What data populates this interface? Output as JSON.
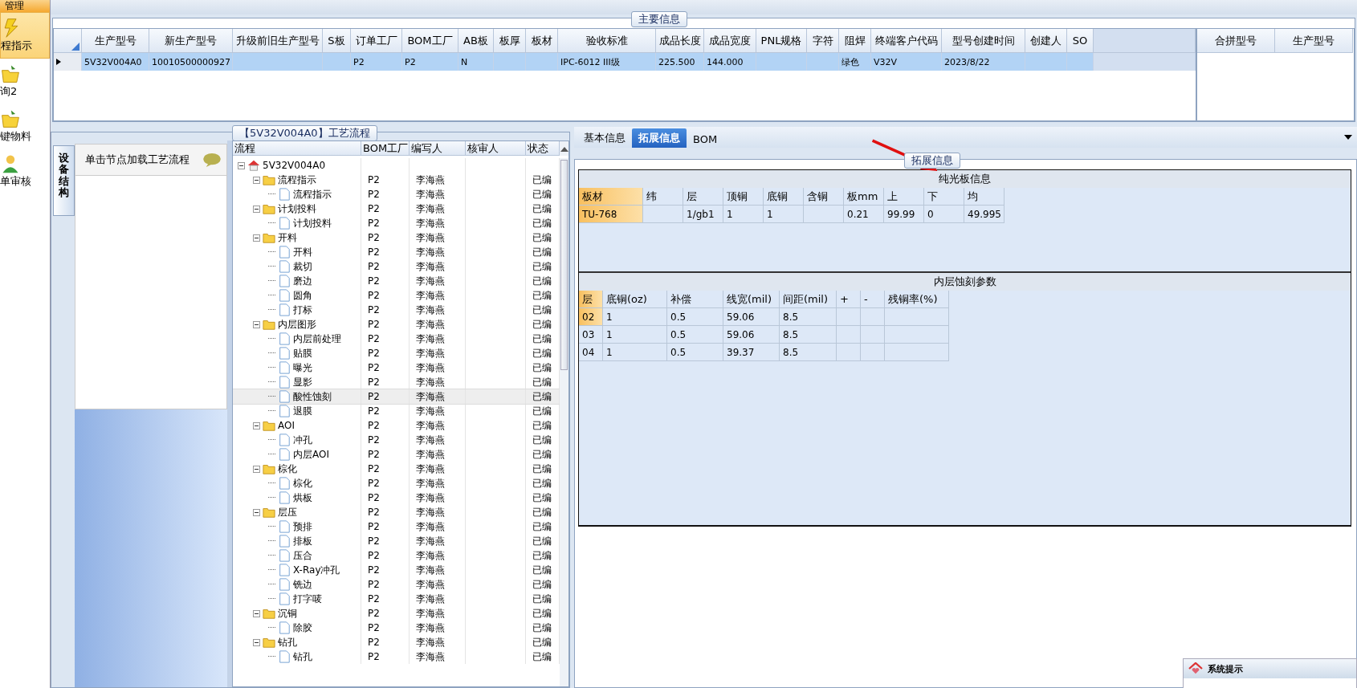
{
  "nav": {
    "section": "管理",
    "items": [
      {
        "label": "程指示",
        "kind": "flash",
        "selected": true
      },
      {
        "label": "询2",
        "kind": "folder",
        "selected": false
      },
      {
        "label": "键物料",
        "kind": "folder",
        "selected": false
      },
      {
        "label": "单审核",
        "kind": "person",
        "selected": false
      }
    ]
  },
  "main_info": {
    "title": "主要信息",
    "columns": [
      "生产型号",
      "新生产型号",
      "升级前旧生产型号",
      "S板",
      "订单工厂",
      "BOM工厂",
      "AB板",
      "板厚",
      "板材",
      "验收标准",
      "成品长度",
      "成品宽度",
      "PNL规格",
      "字符",
      "阻焊",
      "终端客户代码",
      "型号创建时间",
      "创建人",
      "SO"
    ],
    "rows": [
      {
        "selected": true,
        "cells": [
          "5V32V004A0",
          "10010500000927",
          null,
          null,
          "P2",
          "P2",
          "N",
          null,
          null,
          "IPC-6012 III级",
          "225.500",
          "144.000",
          null,
          null,
          "绿色",
          "V32V",
          "2023/8/22",
          null,
          null
        ]
      }
    ]
  },
  "merge_table": {
    "columns": [
      "合拼型号",
      "生产型号"
    ]
  },
  "process": {
    "title": "【5V32V004A0】工艺流程",
    "side_tab": "设备结构",
    "hint": "单击节点加载工艺流程",
    "columns": [
      "流程",
      "BOM工厂",
      "编写人",
      "核审人",
      "状态"
    ],
    "tree": {
      "label": "5V32V004A0",
      "expanded": true,
      "selected": false,
      "children": [
        {
          "label": "流程指示",
          "factory": "P2",
          "author": "李海燕",
          "status": "已编",
          "expanded": true,
          "selected": false,
          "children": [
            {
              "label": "流程指示",
              "factory": "P2",
              "author": "李海燕",
              "status": "已编",
              "selected": false
            }
          ]
        },
        {
          "label": "计划投料",
          "factory": "P2",
          "author": "李海燕",
          "status": "已编",
          "expanded": true,
          "selected": false,
          "children": [
            {
              "label": "计划投料",
              "factory": "P2",
              "author": "李海燕",
              "status": "已编",
              "selected": false
            }
          ]
        },
        {
          "label": "开料",
          "factory": "P2",
          "author": "李海燕",
          "status": "已编",
          "expanded": true,
          "selected": false,
          "children": [
            {
              "label": "开料",
              "factory": "P2",
              "author": "李海燕",
              "status": "已编",
              "selected": false
            },
            {
              "label": "裁切",
              "factory": "P2",
              "author": "李海燕",
              "status": "已编",
              "selected": false
            },
            {
              "label": "磨边",
              "factory": "P2",
              "author": "李海燕",
              "status": "已编",
              "selected": false
            },
            {
              "label": "圆角",
              "factory": "P2",
              "author": "李海燕",
              "status": "已编",
              "selected": false
            },
            {
              "label": "打标",
              "factory": "P2",
              "author": "李海燕",
              "status": "已编",
              "selected": false
            }
          ]
        },
        {
          "label": "内层图形",
          "factory": "P2",
          "author": "李海燕",
          "status": "已编",
          "expanded": true,
          "selected": false,
          "children": [
            {
              "label": "内层前处理",
              "factory": "P2",
              "author": "李海燕",
              "status": "已编",
              "selected": false
            },
            {
              "label": "贴膜",
              "factory": "P2",
              "author": "李海燕",
              "status": "已编",
              "selected": false
            },
            {
              "label": "曝光",
              "factory": "P2",
              "author": "李海燕",
              "status": "已编",
              "selected": false
            },
            {
              "label": "显影",
              "factory": "P2",
              "author": "李海燕",
              "status": "已编",
              "selected": false
            },
            {
              "label": "酸性蚀刻",
              "factory": "P2",
              "author": "李海燕",
              "status": "已编",
              "selected": true
            },
            {
              "label": "退膜",
              "factory": "P2",
              "author": "李海燕",
              "status": "已编",
              "selected": false
            }
          ]
        },
        {
          "label": "AOI",
          "factory": "P2",
          "author": "李海燕",
          "status": "已编",
          "expanded": true,
          "selected": false,
          "children": [
            {
              "label": "冲孔",
              "factory": "P2",
              "author": "李海燕",
              "status": "已编",
              "selected": false
            },
            {
              "label": "内层AOI",
              "factory": "P2",
              "author": "李海燕",
              "status": "已编",
              "selected": false
            }
          ]
        },
        {
          "label": "棕化",
          "factory": "P2",
          "author": "李海燕",
          "status": "已编",
          "expanded": true,
          "selected": false,
          "children": [
            {
              "label": "棕化",
              "factory": "P2",
              "author": "李海燕",
              "status": "已编",
              "selected": false
            },
            {
              "label": "烘板",
              "factory": "P2",
              "author": "李海燕",
              "status": "已编",
              "selected": false
            }
          ]
        },
        {
          "label": "层压",
          "factory": "P2",
          "author": "李海燕",
          "status": "已编",
          "expanded": true,
          "selected": false,
          "children": [
            {
              "label": "预排",
              "factory": "P2",
              "author": "李海燕",
              "status": "已编",
              "selected": false
            },
            {
              "label": "排板",
              "factory": "P2",
              "author": "李海燕",
              "status": "已编",
              "selected": false
            },
            {
              "label": "压合",
              "factory": "P2",
              "author": "李海燕",
              "status": "已编",
              "selected": false
            },
            {
              "label": "X-Ray冲孔",
              "factory": "P2",
              "author": "李海燕",
              "status": "已编",
              "selected": false
            },
            {
              "label": "铣边",
              "factory": "P2",
              "author": "李海燕",
              "status": "已编",
              "selected": false
            },
            {
              "label": "打字唛",
              "factory": "P2",
              "author": "李海燕",
              "status": "已编",
              "selected": false
            }
          ]
        },
        {
          "label": "沉铜",
          "factory": "P2",
          "author": "李海燕",
          "status": "已编",
          "expanded": true,
          "selected": false,
          "children": [
            {
              "label": "除胶",
              "factory": "P2",
              "author": "李海燕",
              "status": "已编",
              "selected": false
            }
          ]
        },
        {
          "label": "钻孔",
          "factory": "P2",
          "author": "李海燕",
          "status": "已编",
          "expanded": true,
          "selected": false,
          "children": [
            {
              "label": "钻孔",
              "factory": "P2",
              "author": "李海燕",
              "status": "已编",
              "selected": false
            }
          ]
        }
      ]
    }
  },
  "detail": {
    "tabs": [
      {
        "label": "基本信息",
        "selected": false
      },
      {
        "label": "拓展信息",
        "selected": true
      },
      {
        "label": "BOM",
        "selected": false
      }
    ],
    "group_title": "拓展信息",
    "plain_board": {
      "title": "纯光板信息",
      "columns": [
        "板材",
        "纬",
        "层",
        "顶铜",
        "底铜",
        "含铜",
        "板mm",
        "上",
        "下",
        "均"
      ],
      "rows": [
        {
          "selected": true,
          "cells": [
            "TU-768",
            null,
            "1/gb1",
            "1",
            "1",
            null,
            "0.21",
            "99.99",
            "0",
            "49.995"
          ]
        }
      ]
    },
    "etch": {
      "title": "内层蚀刻参数",
      "columns": [
        "层",
        "底铜(oz)",
        "补偿",
        "线宽(mil)",
        "间距(mil)",
        "+",
        "-",
        "残铜率(%)"
      ],
      "rows": [
        {
          "selected": true,
          "cells": [
            "02",
            "1",
            "0.5",
            "59.06",
            "8.5",
            null,
            null,
            null
          ]
        },
        {
          "selected": false,
          "cells": [
            "03",
            "1",
            "0.5",
            "59.06",
            "8.5",
            null,
            null,
            null
          ]
        },
        {
          "selected": false,
          "cells": [
            "04",
            "1",
            "0.5",
            "39.37",
            "8.5",
            null,
            null,
            null
          ]
        }
      ]
    }
  },
  "popup": {
    "title": "系统提示"
  }
}
